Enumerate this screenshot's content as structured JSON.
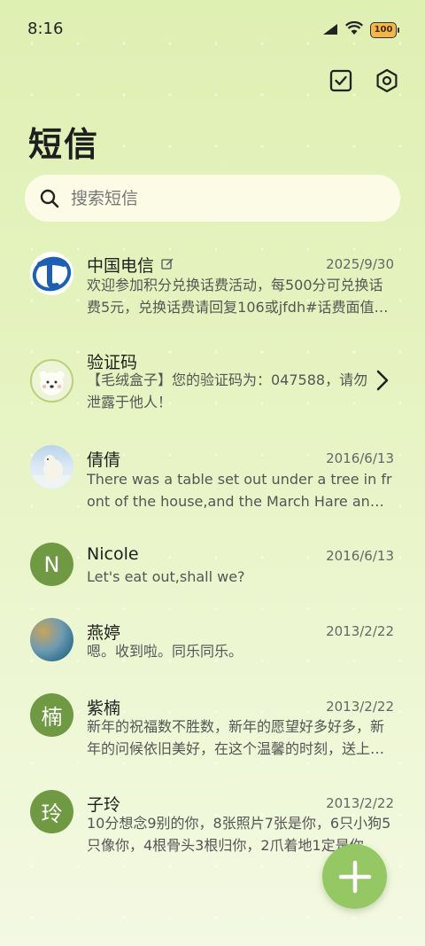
{
  "status": {
    "time": "8:16",
    "battery": "100"
  },
  "page": {
    "title": "短信"
  },
  "search": {
    "placeholder": "搜索短信"
  },
  "conversations": [
    {
      "name": "中国电信",
      "date": "2025/9/30",
      "preview": "欢迎参加积分兑换话费活动，每500分可兑换话费5元，兑换话费请回复106或jfdh#话费面值…"
    },
    {
      "name": "验证码",
      "date": "",
      "preview": "【毛绒盒子】您的验证码为：047588，请勿泄露于他人！"
    },
    {
      "name": "倩倩",
      "date": "2016/6/13",
      "preview": "There was a table set out under a tree in front of the house,and the March Hare and the Hatter"
    },
    {
      "name": "Nicole",
      "date": "2016/6/13",
      "preview": "Let's eat out,shall we?"
    },
    {
      "name": "燕婷",
      "date": "2013/2/22",
      "preview": "嗯。收到啦。同乐同乐。"
    },
    {
      "name": "紫楠",
      "date": "2013/2/22",
      "preview": "新年的祝福数不胜数，新年的愿望好多好多，新年的问候依旧美好，在这个温馨的时刻，送上祝福"
    },
    {
      "name": "子玲",
      "date": "2013/2/22",
      "preview": "10分想念9别的你，8张照片7张是你，6只小狗5只像你，4根骨头3根归你，2爪着地1定是你"
    }
  ],
  "avatars": {
    "nicole": "N",
    "zinan": "楠",
    "ziling": "玲"
  },
  "icons": {
    "signal": "signal-icon",
    "wifi": "wifi-icon",
    "battery": "battery-icon",
    "select": "checkbox-icon",
    "settings": "settings-hex-icon",
    "search": "search-icon",
    "compose": "plus-icon",
    "chevron": "chevron-right-icon"
  },
  "colors": {
    "accent": "#95c765",
    "avatar_green": "#6f9a43",
    "telecom_blue": "#1d5fb3"
  }
}
